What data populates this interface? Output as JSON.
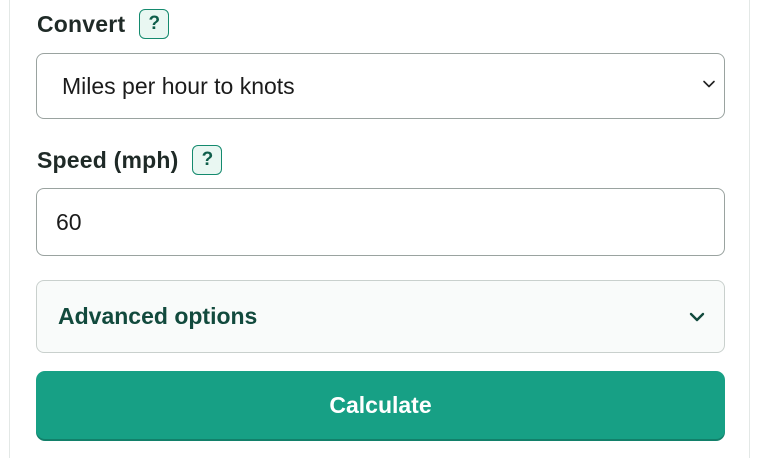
{
  "convert": {
    "label": "Convert",
    "help": "?",
    "selected": "Miles per hour to knots"
  },
  "speed": {
    "label": "Speed (mph)",
    "help": "?",
    "value": "60"
  },
  "advanced": {
    "label": "Advanced options"
  },
  "calculate": {
    "label": "Calculate"
  },
  "colors": {
    "accent": "#17a085",
    "accent_dark": "#124a3d",
    "help_bg": "#e9f7f2",
    "border": "#9aa3a0"
  }
}
